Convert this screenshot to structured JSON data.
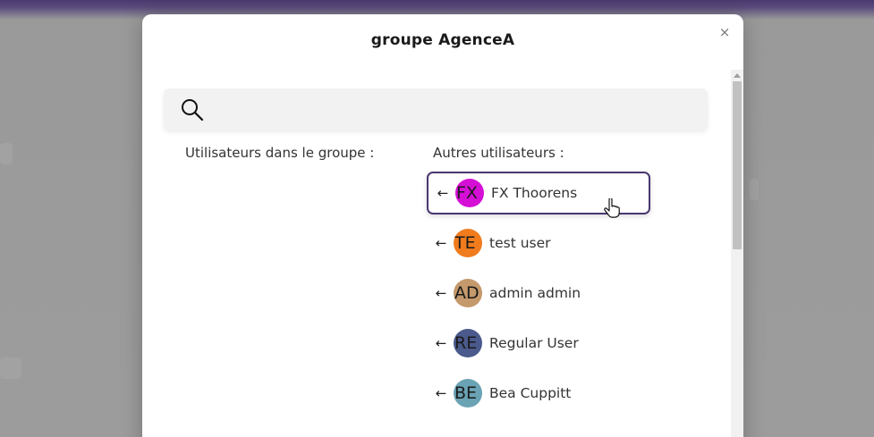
{
  "modal": {
    "title": "groupe AgenceA",
    "close_label": "×"
  },
  "search": {
    "placeholder": "",
    "value": ""
  },
  "columns": {
    "in_group_title": "Utilisateurs dans le groupe :",
    "others_title": "Autres utilisateurs :"
  },
  "other_users": [
    {
      "initials": "FX",
      "name": "FX Thoorens",
      "color": "#d60fd6",
      "icon": "arrow-left-icon"
    },
    {
      "initials": "TE",
      "name": "test user",
      "color": "#f07c1e",
      "icon": "arrow-left-icon"
    },
    {
      "initials": "AD",
      "name": "admin admin",
      "color": "#c4996b",
      "icon": "arrow-left-icon"
    },
    {
      "initials": "RE",
      "name": "Regular User",
      "color": "#4a5a8c",
      "icon": "arrow-left-icon"
    },
    {
      "initials": "BE",
      "name": "Bea Cuppitt",
      "color": "#6aa3b4",
      "icon": "arrow-left-icon"
    }
  ],
  "colors": {
    "accent": "#4a3770"
  }
}
